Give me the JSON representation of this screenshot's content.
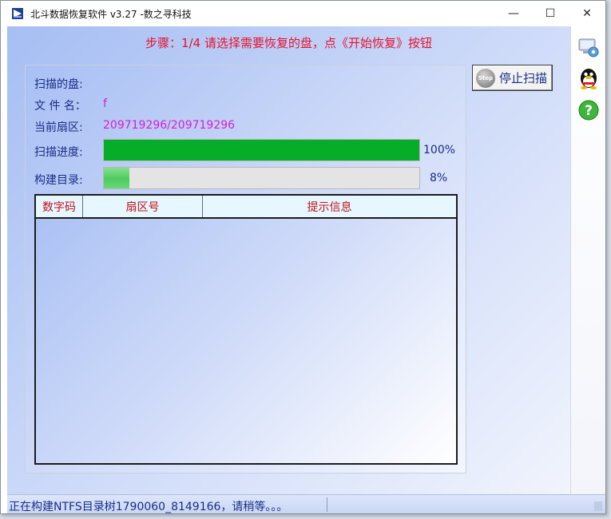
{
  "window": {
    "title": "北斗数据恢复软件 v3.27 -数之寻科技",
    "minimize_glyph": "—",
    "maximize_glyph": "☐",
    "close_glyph": "✕"
  },
  "step": {
    "text": "步骤：1/4 请选择需要恢复的盘，点《开始恢复》按钮"
  },
  "scan": {
    "disk_label": "扫描的盘:",
    "disk_value": "",
    "filename_label": "文 件 名：",
    "filename_value": "f",
    "sector_label": "当前扇区:",
    "sector_value": "209719296/209719296",
    "progress_label": "扫描进度:",
    "progress_text": "100%",
    "progress_value": 100,
    "build_label": "构建目录:",
    "build_text": "8%",
    "build_value": 8
  },
  "table": {
    "columns": [
      "数字码",
      "扇区号",
      "提示信息"
    ],
    "rows": []
  },
  "buttons": {
    "stop_icon_text": "Stop",
    "stop_label": "停止扫描"
  },
  "toolbar": {
    "icons": [
      "settings-computer-icon",
      "qq-penguin-icon",
      "help-question-icon"
    ],
    "help_glyph": "?"
  },
  "status": {
    "text": "正在构建NTFS目录树1790060_8149166，请稍等。。。"
  },
  "colors": {
    "step_text": "#e8112d",
    "label_text": "#1b2d86",
    "value_text": "#d61fcf",
    "progress_fill": "#06ad29",
    "header_text": "#c0131a"
  }
}
